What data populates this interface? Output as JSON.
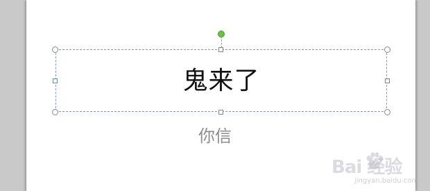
{
  "slide": {
    "title_text": "鬼来了",
    "subtitle_text": "你信"
  },
  "watermark": {
    "text": "Bai  经验",
    "sub": "jingyan.baidu.com",
    "icon": "baidu-paw-icon"
  },
  "colors": {
    "selection_border": "#7f97b3",
    "rotate_handle": "#6cc04a",
    "subtitle": "#8c8c8c",
    "background": "#c9c9c9"
  }
}
